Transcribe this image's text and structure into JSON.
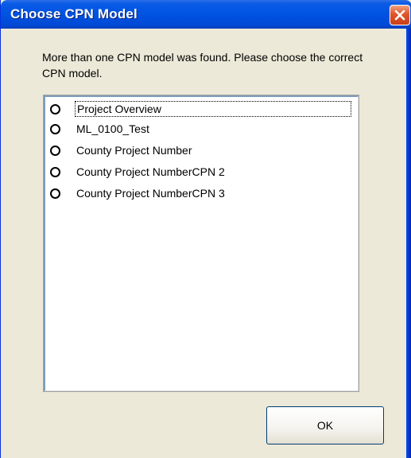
{
  "window": {
    "title": "Choose CPN Model",
    "close_icon": "close-icon"
  },
  "message": "More than one CPN model was found.  Please choose the correct CPN model.",
  "models": [
    {
      "label": "Project Overview",
      "selected": false,
      "focused": true
    },
    {
      "label": "ML_0100_Test",
      "selected": false,
      "focused": false
    },
    {
      "label": "County Project Number",
      "selected": false,
      "focused": false
    },
    {
      "label": "County Project NumberCPN 2",
      "selected": false,
      "focused": false
    },
    {
      "label": "County Project NumberCPN 3",
      "selected": false,
      "focused": false
    }
  ],
  "buttons": {
    "ok_label": "OK"
  },
  "colors": {
    "titlebar": "#0053e1",
    "dialog_bg": "#ece9d8",
    "close_button": "#e0552a"
  }
}
